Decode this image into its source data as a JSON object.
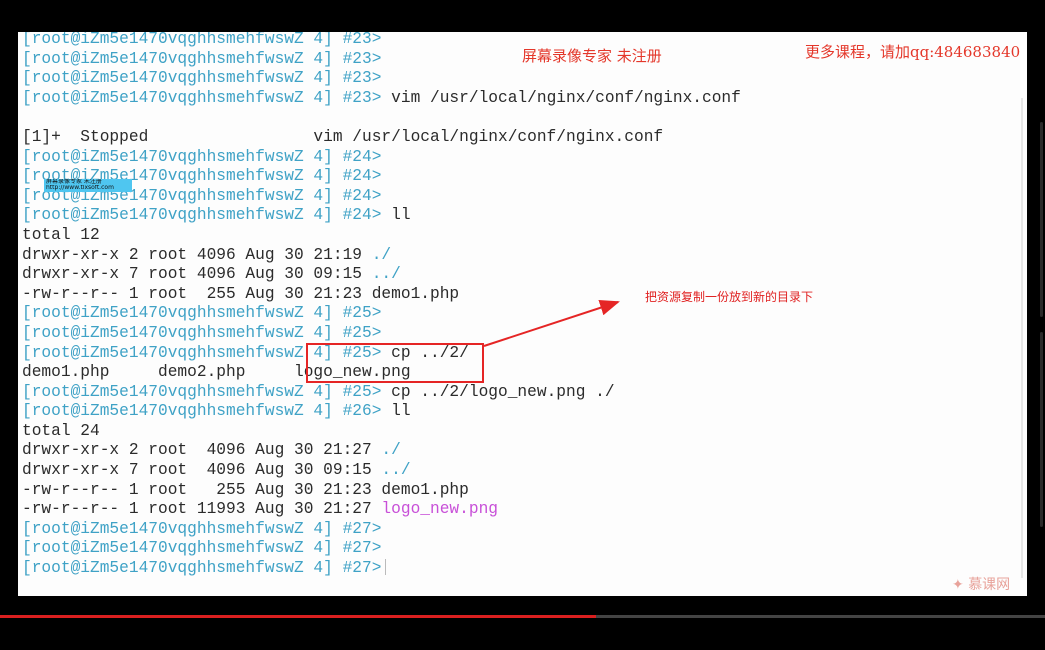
{
  "terminal": {
    "lines": [
      [
        {
          "t": "[root@iZm5e1470vqghhsmehfwswZ 4] ",
          "c": "dir"
        },
        {
          "t": "#23>",
          "c": "dir"
        }
      ],
      [
        {
          "t": "[root@iZm5e1470vqghhsmehfwswZ 4] ",
          "c": "dir"
        },
        {
          "t": "#23>",
          "c": "dir"
        }
      ],
      [
        {
          "t": "[root@iZm5e1470vqghhsmehfwswZ 4] ",
          "c": "dir"
        },
        {
          "t": "#23>",
          "c": "dir"
        }
      ],
      [
        {
          "t": "[root@iZm5e1470vqghhsmehfwswZ 4] ",
          "c": "dir"
        },
        {
          "t": "#23>",
          "c": "dir"
        },
        {
          "t": " vim /usr/local/nginx/conf/nginx.conf",
          "c": ""
        }
      ],
      [
        {
          "t": "",
          "c": ""
        }
      ],
      [
        {
          "t": "[1]+  Stopped                 vim /usr/local/nginx/conf/nginx.conf",
          "c": ""
        }
      ],
      [
        {
          "t": "[root@iZm5e1470vqghhsmehfwswZ 4] ",
          "c": "dir"
        },
        {
          "t": "#24>",
          "c": "dir"
        }
      ],
      [
        {
          "t": "[root@iZm5e1470vqghhsmehfwswZ 4] ",
          "c": "dir"
        },
        {
          "t": "#24>",
          "c": "dir"
        }
      ],
      [
        {
          "t": "[root@iZm5e1470vqghhsmehfwswZ 4] ",
          "c": "dir"
        },
        {
          "t": "#24>",
          "c": "dir"
        }
      ],
      [
        {
          "t": "[root@iZm5e1470vqghhsmehfwswZ 4] ",
          "c": "dir"
        },
        {
          "t": "#24>",
          "c": "dir"
        },
        {
          "t": " ll",
          "c": ""
        }
      ],
      [
        {
          "t": "total 12",
          "c": ""
        }
      ],
      [
        {
          "t": "drwxr-xr-x 2 root 4096 Aug 30 21:19 ",
          "c": ""
        },
        {
          "t": "./",
          "c": "dir"
        }
      ],
      [
        {
          "t": "drwxr-xr-x 7 root 4096 Aug 30 09:15 ",
          "c": ""
        },
        {
          "t": "../",
          "c": "dir"
        }
      ],
      [
        {
          "t": "-rw-r--r-- 1 root  255 Aug 30 21:23 demo1.php",
          "c": ""
        }
      ],
      [
        {
          "t": "[root@iZm5e1470vqghhsmehfwswZ 4] ",
          "c": "dir"
        },
        {
          "t": "#25>",
          "c": "dir"
        }
      ],
      [
        {
          "t": "[root@iZm5e1470vqghhsmehfwswZ 4] ",
          "c": "dir"
        },
        {
          "t": "#25>",
          "c": "dir"
        }
      ],
      [
        {
          "t": "[root@iZm5e1470vqghhsmehfwswZ 4] ",
          "c": "dir"
        },
        {
          "t": "#25>",
          "c": "dir"
        },
        {
          "t": " cp ../2/",
          "c": ""
        }
      ],
      [
        {
          "t": "demo1.php     demo2.php     logo_new.png",
          "c": ""
        }
      ],
      [
        {
          "t": "[root@iZm5e1470vqghhsmehfwswZ 4] ",
          "c": "dir"
        },
        {
          "t": "#25>",
          "c": "dir"
        },
        {
          "t": " cp ../2/logo_new.png ./",
          "c": ""
        }
      ],
      [
        {
          "t": "[root@iZm5e1470vqghhsmehfwswZ 4] ",
          "c": "dir"
        },
        {
          "t": "#26>",
          "c": "dir"
        },
        {
          "t": " ll",
          "c": ""
        }
      ],
      [
        {
          "t": "total 24",
          "c": ""
        }
      ],
      [
        {
          "t": "drwxr-xr-x 2 root  4096 Aug 30 21:27 ",
          "c": ""
        },
        {
          "t": "./",
          "c": "dir"
        }
      ],
      [
        {
          "t": "drwxr-xr-x 7 root  4096 Aug 30 09:15 ",
          "c": ""
        },
        {
          "t": "../",
          "c": "dir"
        }
      ],
      [
        {
          "t": "-rw-r--r-- 1 root   255 Aug 30 21:23 demo1.php",
          "c": ""
        }
      ],
      [
        {
          "t": "-rw-r--r-- 1 root 11993 Aug 30 21:27 ",
          "c": ""
        },
        {
          "t": "logo_new.png",
          "c": "exe"
        }
      ],
      [
        {
          "t": "[root@iZm5e1470vqghhsmehfwswZ 4] ",
          "c": "dir"
        },
        {
          "t": "#27>",
          "c": "dir"
        }
      ],
      [
        {
          "t": "[root@iZm5e1470vqghhsmehfwswZ 4] ",
          "c": "dir"
        },
        {
          "t": "#27>",
          "c": "dir"
        }
      ],
      [
        {
          "t": "[root@iZm5e1470vqghhsmehfwswZ 4] ",
          "c": "dir"
        },
        {
          "t": "#27>",
          "c": "dir"
        }
      ]
    ]
  },
  "watermarks": {
    "center": "屏幕录像专家  未注册",
    "right": "更多课程，请加qq:484683840",
    "badge_title": "屏幕录像专家      未注册",
    "badge_url": "http://www.tlxsoft.com"
  },
  "annotation": {
    "text": "把资源复制一份放到新的目录下"
  },
  "logo": {
    "text": "慕课网",
    "icon": "flame-icon"
  },
  "colors": {
    "prompt": "#3fa2c6",
    "executable": "#c850d8",
    "annotation": "#e02121",
    "watermark": "#e4372a"
  },
  "video": {
    "progress_percent": 57
  }
}
